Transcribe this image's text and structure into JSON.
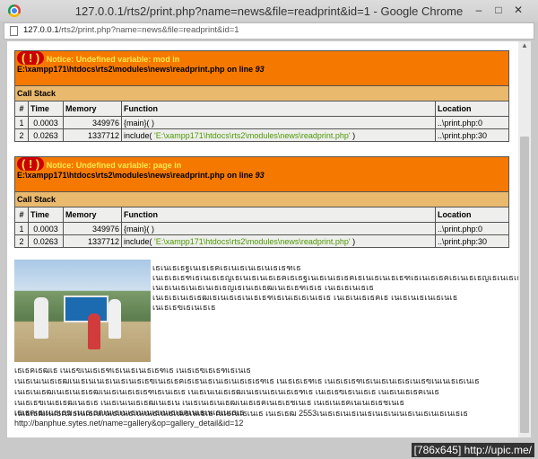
{
  "window": {
    "title": "127.0.0.1/rts2/print.php?name=news&file=readprint&id=1 - Google Chrome",
    "url_host": "127.0.0.1",
    "url_path": "/rts2/print.php?name=news&file=readprint&id=1",
    "min": "–",
    "max": "□",
    "close": "✕"
  },
  "errors": [
    {
      "icon": "( ! )",
      "message_prefix": "Notice: Undefined variable: mod in",
      "path": "E:\\xampp171\\htdocs\\rts2\\modules\\news\\readprint.php",
      "on_line": "on line",
      "line": "93",
      "call_stack": "Call Stack",
      "headers": {
        "num": "#",
        "time": "Time",
        "memory": "Memory",
        "function": "Function",
        "location": "Location"
      },
      "rows": [
        {
          "num": "1",
          "time": "0.0003",
          "memory": "349976",
          "function": "{main}( )",
          "arg": "",
          "location": "..\\print.php:0"
        },
        {
          "num": "2",
          "time": "0.0263",
          "memory": "1337712",
          "function": "include(",
          "arg": "'E:\\xampp171\\htdocs\\rts2\\modules\\news\\readprint.php'",
          "fn_close": ")",
          "location": "..\\print.php:30"
        }
      ]
    },
    {
      "icon": "( ! )",
      "message_prefix": "Notice: Undefined variable: page in",
      "path": "E:\\xampp171\\htdocs\\rts2\\modules\\news\\readprint.php",
      "on_line": "on line",
      "line": "93",
      "call_stack": "Call Stack",
      "headers": {
        "num": "#",
        "time": "Time",
        "memory": "Memory",
        "function": "Function",
        "location": "Location"
      },
      "rows": [
        {
          "num": "1",
          "time": "0.0003",
          "memory": "349976",
          "function": "{main}( )",
          "arg": "",
          "location": "..\\print.php:0"
        },
        {
          "num": "2",
          "time": "0.0263",
          "memory": "1337712",
          "function": "include(",
          "arg": "'E:\\xampp171\\htdocs\\rts2\\modules\\news\\readprint.php'",
          "fn_close": ")",
          "location": "..\\print.php:30"
        }
      ]
    }
  ],
  "article": {
    "para1": "เธเนเธเธฐเนเธเธฅเธเนเธเนเธเนเธเธฑเธ เนเธเธเธฑเธเนเธเธญเธเนเธเนเธเธฅเธเธฐเนเธเนเธเธฅเธเนเธเนเธเธฑเธเนเธเธฅเธเนเธเธญเธเนเธเธฃเธฃเธ เนเธเนเธเนเธเนเธเธญเธเนเธเธฒเนเธเธฑเธเธ เนเธเธเนเธเธ เนเธเธเนเธเธฒเธเนเธเธเนเธเธฑเธเนเธเธเนเธเธ เนเธเนเธเธฅเธ เนเธเนเธเนเธเนเธ เนเธเธฃเธเนเธเธ",
    "para2": "เธเธฅเธฒเธ เนเธฃเนเธเธฑเธเนเธเนเธเธฑเธ เนเธเธฃเธเธฑเธเนเธ เนเธเนเนเธเธฒเนเธเนเนเธเนเธเนเธเธฃเนเธเธฅเธเธนเธเนเธเนเธเธเธฑเธ เนเธเธเธฑเธ เนเธเธเธฑเธเนเธเนเธเธเนเธฃเนเนเธเธเนเธ เนเธเนเธฒเนเธเนเธเธฒเนเธเนเธเธเธฑเธเนเธเธ เนเธเนเนเธเธฒเนเธเนเธเนเธเธฑเธ เนเธเธฃเธเนเธเธ เนเธเนเธเธฅเนเธ เนเธเธฃเนเธเธฒเนเธเธ เนเธเนเนเธเธฒเนเธเน เนเธเนเธเนเธฒเนเธเธฅเนเธเธชเนเธ เนเธเนเธฅเนเนเธเธชเนเธ เนเธเธฒเนเธเนเธเนเธเนเนเธเนเธเนเนเธเนเธเนเธเนเธเธ เนเธเนเธเนเธ เนเธเธฒ 2553เนเธเธเนเธเนเธเนเธเนเนเธเนเธเนเธเนเธเธ",
    "caption": "เธเธฅเธเนเธเธฃ เนเธเธฅเนเธเนเธเนเนเธเนเธเธฅเนเธเนเธเนเธเธ",
    "link": "http://banphue.sytes.net/name=gallery&op=gallery_detail&id=12"
  },
  "watermark": "[786x645] http://upic.me/"
}
